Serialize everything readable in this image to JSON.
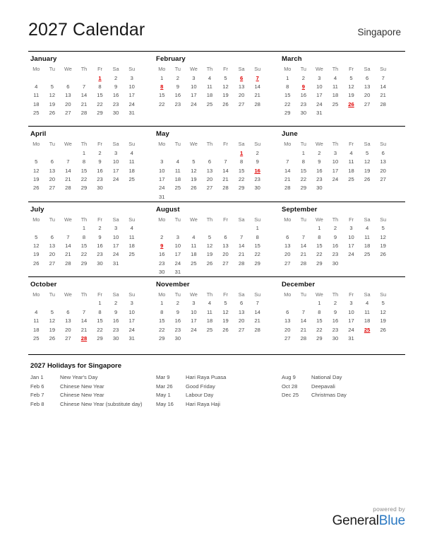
{
  "header": {
    "title": "2027 Calendar",
    "region": "Singapore"
  },
  "weekdays": [
    "Mo",
    "Tu",
    "We",
    "Th",
    "Fr",
    "Sa",
    "Su"
  ],
  "colors": {
    "holiday": "#e00000",
    "text": "#4a4a4a",
    "weekday_header": "#6d6d6d",
    "logo_blue": "#2a78c2",
    "rule": "#000000"
  },
  "months": [
    {
      "name": "January",
      "lead_blanks": 4,
      "days": 31,
      "holidays": [
        1
      ],
      "weeks": [
        [
          "",
          "",
          "",
          "",
          "1",
          "2",
          "3"
        ],
        [
          "4",
          "5",
          "6",
          "7",
          "8",
          "9",
          "10"
        ],
        [
          "11",
          "12",
          "13",
          "14",
          "15",
          "16",
          "17"
        ],
        [
          "18",
          "19",
          "20",
          "21",
          "22",
          "23",
          "24"
        ],
        [
          "25",
          "26",
          "27",
          "28",
          "29",
          "30",
          "31"
        ],
        [
          "",
          "",
          "",
          "",
          "",
          "",
          ""
        ]
      ]
    },
    {
      "name": "February",
      "lead_blanks": 0,
      "days": 28,
      "holidays": [
        6,
        7,
        8
      ],
      "weeks": [
        [
          "1",
          "2",
          "3",
          "4",
          "5",
          "6",
          "7"
        ],
        [
          "8",
          "9",
          "10",
          "11",
          "12",
          "13",
          "14"
        ],
        [
          "15",
          "16",
          "17",
          "18",
          "19",
          "20",
          "21"
        ],
        [
          "22",
          "23",
          "24",
          "25",
          "26",
          "27",
          "28"
        ],
        [
          "",
          "",
          "",
          "",
          "",
          "",
          ""
        ],
        [
          "",
          "",
          "",
          "",
          "",
          "",
          ""
        ]
      ]
    },
    {
      "name": "March",
      "lead_blanks": 0,
      "days": 31,
      "holidays": [
        9,
        26
      ],
      "weeks": [
        [
          "1",
          "2",
          "3",
          "4",
          "5",
          "6",
          "7"
        ],
        [
          "8",
          "9",
          "10",
          "11",
          "12",
          "13",
          "14"
        ],
        [
          "15",
          "16",
          "17",
          "18",
          "19",
          "20",
          "21"
        ],
        [
          "22",
          "23",
          "24",
          "25",
          "26",
          "27",
          "28"
        ],
        [
          "29",
          "30",
          "31",
          "",
          "",
          "",
          ""
        ],
        [
          "",
          "",
          "",
          "",
          "",
          "",
          ""
        ]
      ]
    },
    {
      "name": "April",
      "lead_blanks": 3,
      "days": 30,
      "holidays": [],
      "weeks": [
        [
          "",
          "",
          "",
          "1",
          "2",
          "3",
          "4"
        ],
        [
          "5",
          "6",
          "7",
          "8",
          "9",
          "10",
          "11"
        ],
        [
          "12",
          "13",
          "14",
          "15",
          "16",
          "17",
          "18"
        ],
        [
          "19",
          "20",
          "21",
          "22",
          "23",
          "24",
          "25"
        ],
        [
          "26",
          "27",
          "28",
          "29",
          "30",
          "",
          ""
        ],
        [
          "",
          "",
          "",
          "",
          "",
          "",
          ""
        ]
      ]
    },
    {
      "name": "May",
      "lead_blanks": 5,
      "days": 31,
      "holidays": [
        1,
        16
      ],
      "weeks": [
        [
          "",
          "",
          "",
          "",
          "",
          "1",
          "2"
        ],
        [
          "3",
          "4",
          "5",
          "6",
          "7",
          "8",
          "9"
        ],
        [
          "10",
          "11",
          "12",
          "13",
          "14",
          "15",
          "16"
        ],
        [
          "17",
          "18",
          "19",
          "20",
          "21",
          "22",
          "23"
        ],
        [
          "24",
          "25",
          "26",
          "27",
          "28",
          "29",
          "30"
        ],
        [
          "31",
          "",
          "",
          "",
          "",
          "",
          ""
        ]
      ]
    },
    {
      "name": "June",
      "lead_blanks": 1,
      "days": 30,
      "holidays": [],
      "weeks": [
        [
          "",
          "1",
          "2",
          "3",
          "4",
          "5",
          "6"
        ],
        [
          "7",
          "8",
          "9",
          "10",
          "11",
          "12",
          "13"
        ],
        [
          "14",
          "15",
          "16",
          "17",
          "18",
          "19",
          "20"
        ],
        [
          "21",
          "22",
          "23",
          "24",
          "25",
          "26",
          "27"
        ],
        [
          "28",
          "29",
          "30",
          "",
          "",
          "",
          ""
        ],
        [
          "",
          "",
          "",
          "",
          "",
          "",
          ""
        ]
      ]
    },
    {
      "name": "July",
      "lead_blanks": 3,
      "days": 31,
      "holidays": [],
      "weeks": [
        [
          "",
          "",
          "",
          "1",
          "2",
          "3",
          "4"
        ],
        [
          "5",
          "6",
          "7",
          "8",
          "9",
          "10",
          "11"
        ],
        [
          "12",
          "13",
          "14",
          "15",
          "16",
          "17",
          "18"
        ],
        [
          "19",
          "20",
          "21",
          "22",
          "23",
          "24",
          "25"
        ],
        [
          "26",
          "27",
          "28",
          "29",
          "30",
          "31",
          ""
        ],
        [
          "",
          "",
          "",
          "",
          "",
          "",
          ""
        ]
      ]
    },
    {
      "name": "August",
      "lead_blanks": 6,
      "days": 31,
      "holidays": [
        9
      ],
      "weeks": [
        [
          "",
          "",
          "",
          "",
          "",
          "",
          "1"
        ],
        [
          "2",
          "3",
          "4",
          "5",
          "6",
          "7",
          "8"
        ],
        [
          "9",
          "10",
          "11",
          "12",
          "13",
          "14",
          "15"
        ],
        [
          "16",
          "17",
          "18",
          "19",
          "20",
          "21",
          "22"
        ],
        [
          "23",
          "24",
          "25",
          "26",
          "27",
          "28",
          "29"
        ],
        [
          "30",
          "31",
          "",
          "",
          "",
          "",
          ""
        ]
      ]
    },
    {
      "name": "September",
      "lead_blanks": 2,
      "days": 30,
      "holidays": [],
      "weeks": [
        [
          "",
          "",
          "1",
          "2",
          "3",
          "4",
          "5"
        ],
        [
          "6",
          "7",
          "8",
          "9",
          "10",
          "11",
          "12"
        ],
        [
          "13",
          "14",
          "15",
          "16",
          "17",
          "18",
          "19"
        ],
        [
          "20",
          "21",
          "22",
          "23",
          "24",
          "25",
          "26"
        ],
        [
          "27",
          "28",
          "29",
          "30",
          "",
          "",
          ""
        ],
        [
          "",
          "",
          "",
          "",
          "",
          "",
          ""
        ]
      ]
    },
    {
      "name": "October",
      "lead_blanks": 4,
      "days": 31,
      "holidays": [
        28
      ],
      "weeks": [
        [
          "",
          "",
          "",
          "",
          "1",
          "2",
          "3"
        ],
        [
          "4",
          "5",
          "6",
          "7",
          "8",
          "9",
          "10"
        ],
        [
          "11",
          "12",
          "13",
          "14",
          "15",
          "16",
          "17"
        ],
        [
          "18",
          "19",
          "20",
          "21",
          "22",
          "23",
          "24"
        ],
        [
          "25",
          "26",
          "27",
          "28",
          "29",
          "30",
          "31"
        ],
        [
          "",
          "",
          "",
          "",
          "",
          "",
          ""
        ]
      ]
    },
    {
      "name": "November",
      "lead_blanks": 0,
      "days": 30,
      "holidays": [],
      "weeks": [
        [
          "1",
          "2",
          "3",
          "4",
          "5",
          "6",
          "7"
        ],
        [
          "8",
          "9",
          "10",
          "11",
          "12",
          "13",
          "14"
        ],
        [
          "15",
          "16",
          "17",
          "18",
          "19",
          "20",
          "21"
        ],
        [
          "22",
          "23",
          "24",
          "25",
          "26",
          "27",
          "28"
        ],
        [
          "29",
          "30",
          "",
          "",
          "",
          "",
          ""
        ],
        [
          "",
          "",
          "",
          "",
          "",
          "",
          ""
        ]
      ]
    },
    {
      "name": "December",
      "lead_blanks": 2,
      "days": 31,
      "holidays": [
        25
      ],
      "weeks": [
        [
          "",
          "",
          "1",
          "2",
          "3",
          "4",
          "5"
        ],
        [
          "6",
          "7",
          "8",
          "9",
          "10",
          "11",
          "12"
        ],
        [
          "13",
          "14",
          "15",
          "16",
          "17",
          "18",
          "19"
        ],
        [
          "20",
          "21",
          "22",
          "23",
          "24",
          "25",
          "26"
        ],
        [
          "27",
          "28",
          "29",
          "30",
          "31",
          "",
          ""
        ],
        [
          "",
          "",
          "",
          "",
          "",
          "",
          ""
        ]
      ]
    }
  ],
  "holidays_section": {
    "title": "2027 Holidays for Singapore",
    "columns": [
      [
        {
          "date": "Jan 1",
          "name": "New Year's Day"
        },
        {
          "date": "Feb 6",
          "name": "Chinese New Year"
        },
        {
          "date": "Feb 7",
          "name": "Chinese New Year"
        },
        {
          "date": "Feb 8",
          "name": "Chinese New Year (substitute day)"
        }
      ],
      [
        {
          "date": "Mar 9",
          "name": "Hari Raya Puasa"
        },
        {
          "date": "Mar 26",
          "name": "Good Friday"
        },
        {
          "date": "May 1",
          "name": "Labour Day"
        },
        {
          "date": "May 16",
          "name": "Hari Raya Haji"
        }
      ],
      [
        {
          "date": "Aug 9",
          "name": "National Day"
        },
        {
          "date": "Oct 28",
          "name": "Deepavali"
        },
        {
          "date": "Dec 25",
          "name": "Christmas Day"
        }
      ]
    ]
  },
  "footer": {
    "powered_by": "powered by",
    "logo_part1": "General",
    "logo_part2": "Blue"
  }
}
